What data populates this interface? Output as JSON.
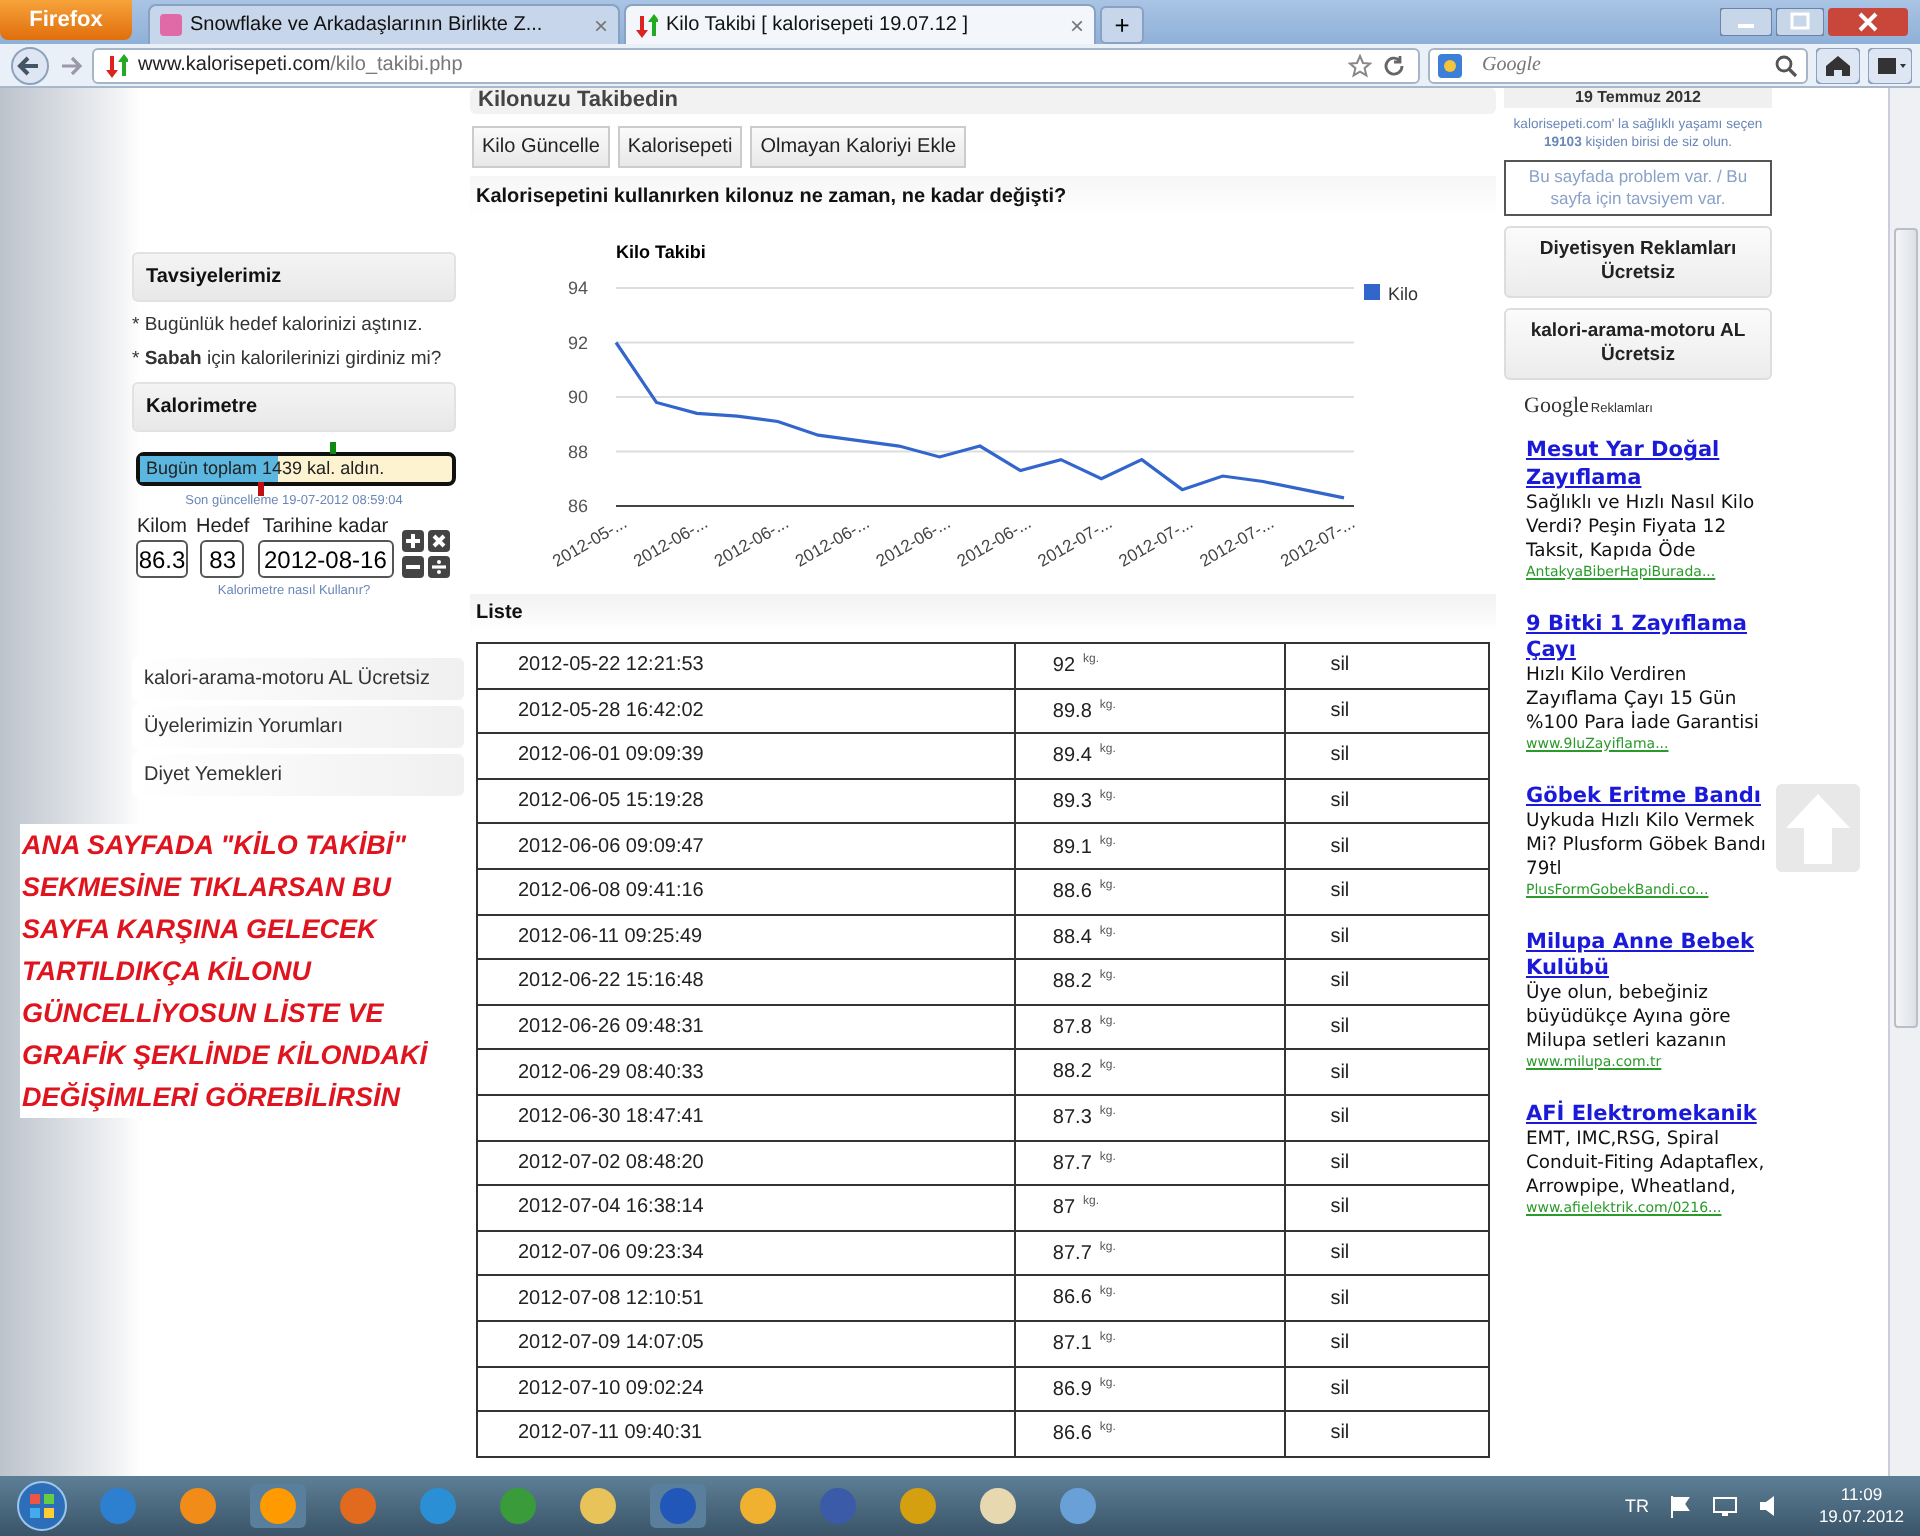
{
  "browser": {
    "menu_button": "Firefox",
    "tabs": [
      {
        "title": "Snowflake ve Arkadaşlarının Birlikte Z...",
        "selected": false
      },
      {
        "title": "Kilo Takibi [ kalorisepeti 19.07.12 ]",
        "selected": true
      }
    ],
    "close_label": "×",
    "new_tab_label": "+",
    "url_domain": "www.kalorisepeti.com",
    "url_path": "/kilo_takibi.php",
    "search": {
      "placeholder": "Google"
    }
  },
  "left": {
    "recommend_title": "Tavsiyelerimiz",
    "recommendations": [
      "* Bugünlük hedef kalorinizi aştınız.",
      "* **Sabah** için kalorilerinizi girdiniz mi?"
    ],
    "meter_title": "Kalorimetre",
    "meter": {
      "text": "Bugün toplam 1439 kal. aldın.",
      "level": 0.44
    },
    "last_update": "Son güncelleme 19-07-2012 08:59:04",
    "fields": [
      {
        "label": "Kilom",
        "value": "86.3"
      },
      {
        "label": "Hedef",
        "value": "83"
      },
      {
        "label": "Tarihine kadar",
        "value": "2012-08-16"
      }
    ],
    "help_link": "Kalorimetre nasıl Kullanır?",
    "menu": [
      "kalori-arama-motoru AL Ücretsiz",
      "Üyelerimizin Yorumları",
      "Diyet Yemekleri"
    ],
    "annotation": "ANA SAYFADA \"KİLO TAKİBİ\" SEKMESİNE TIKLARSAN BU SAYFA KARŞINA GELECEK TARTILDIKÇA KİLONU GÜNCELLİYOSUN LİSTE VE GRAFİK ŞEKLİNDE KİLONDAKİ DEĞİŞİMLERİ GÖREBİLİRSİN"
  },
  "main": {
    "title": "Kilonuzu Takibedin",
    "buttons": [
      "Kilo Güncelle",
      "Kalorisepeti",
      "Olmayan Kaloriyi Ekle"
    ],
    "question": "Kalorisepetini kullanırken kilonuz ne zaman, ne kadar değişti?",
    "chart_data": {
      "type": "line",
      "title": "Kilo Takibi",
      "categories": [
        "2012-05-...",
        null,
        "2012-06-...",
        null,
        "2012-06-...",
        null,
        "2012-06-...",
        null,
        "2012-06-...",
        null,
        "2012-06-...",
        null,
        "2012-07-...",
        null,
        "2012-07-...",
        null,
        "2012-07-...",
        null,
        "2012-07-..."
      ],
      "series": [
        {
          "name": "Kilo",
          "color": "#3366cc",
          "values": [
            92,
            89.8,
            89.4,
            89.3,
            89.1,
            88.6,
            88.4,
            88.2,
            87.8,
            88.2,
            87.3,
            87.7,
            87,
            87.7,
            86.6,
            87.1,
            86.9,
            86.6,
            86.3
          ]
        }
      ],
      "ylim": [
        86,
        94
      ],
      "yticks": [
        86,
        88,
        90,
        92,
        94
      ],
      "grid": true
    },
    "list_title": "Liste",
    "rows": [
      {
        "date": "2012-05-22 12:21:53",
        "weight": "92",
        "unit": "kg.",
        "action": "sil"
      },
      {
        "date": "2012-05-28 16:42:02",
        "weight": "89.8",
        "unit": "kg.",
        "action": "sil"
      },
      {
        "date": "2012-06-01 09:09:39",
        "weight": "89.4",
        "unit": "kg.",
        "action": "sil"
      },
      {
        "date": "2012-06-05 15:19:28",
        "weight": "89.3",
        "unit": "kg.",
        "action": "sil"
      },
      {
        "date": "2012-06-06 09:09:47",
        "weight": "89.1",
        "unit": "kg.",
        "action": "sil"
      },
      {
        "date": "2012-06-08 09:41:16",
        "weight": "88.6",
        "unit": "kg.",
        "action": "sil"
      },
      {
        "date": "2012-06-11 09:25:49",
        "weight": "88.4",
        "unit": "kg.",
        "action": "sil"
      },
      {
        "date": "2012-06-22 15:16:48",
        "weight": "88.2",
        "unit": "kg.",
        "action": "sil"
      },
      {
        "date": "2012-06-26 09:48:31",
        "weight": "87.8",
        "unit": "kg.",
        "action": "sil"
      },
      {
        "date": "2012-06-29 08:40:33",
        "weight": "88.2",
        "unit": "kg.",
        "action": "sil"
      },
      {
        "date": "2012-06-30 18:47:41",
        "weight": "87.3",
        "unit": "kg.",
        "action": "sil"
      },
      {
        "date": "2012-07-02 08:48:20",
        "weight": "87.7",
        "unit": "kg.",
        "action": "sil"
      },
      {
        "date": "2012-07-04 16:38:14",
        "weight": "87",
        "unit": "kg.",
        "action": "sil"
      },
      {
        "date": "2012-07-06 09:23:34",
        "weight": "87.7",
        "unit": "kg.",
        "action": "sil"
      },
      {
        "date": "2012-07-08 12:10:51",
        "weight": "86.6",
        "unit": "kg.",
        "action": "sil"
      },
      {
        "date": "2012-07-09 14:07:05",
        "weight": "87.1",
        "unit": "kg.",
        "action": "sil"
      },
      {
        "date": "2012-07-10 09:02:24",
        "weight": "86.9",
        "unit": "kg.",
        "action": "sil"
      },
      {
        "date": "2012-07-11 09:40:31",
        "weight": "86.6",
        "unit": "kg.",
        "action": "sil"
      }
    ]
  },
  "right": {
    "date": "19 Temmuz 2012",
    "members_text": "kalorisepeti.com' la sağlıklı yaşamı seçen **19103** kişiden birisi de siz olun.",
    "feedback": "Bu sayfada problem var. / Bu sayfa için tavsiyem var.",
    "buttons": [
      "Diyetisyen Reklamları Ücretsiz",
      "kalori-arama-motoru AL Ücretsiz"
    ],
    "ads_logo": "Google",
    "ads_label": "Reklamları",
    "ads": [
      {
        "title": "Mesut Yar Doğal Zayıflama",
        "body": "Sağlıklı ve Hızlı Nasıl Kilo Verdi? Peşin Fiyata 12 Taksit, Kapıda Öde",
        "url": "AntakyaBiberHapiBurada..."
      },
      {
        "title": "9 Bitki 1 Zayıflama Çayı",
        "body": "Hızlı Kilo Verdiren Zayıflama Çayı 15 Gün %100 Para İade Garantisi",
        "url": "www.9luZayiflama..."
      },
      {
        "title": "Göbek Eritme Bandı",
        "body": "Uykuda Hızlı Kilo Vermek Mi? Plusform Göbek Bandı 79tl",
        "url": "PlusFormGobekBandi.co..."
      },
      {
        "title": "Milupa Anne Bebek Kulübü",
        "body": "Üye olun, bebeğiniz büyüdükçe Ayına göre Milupa setleri kazanın",
        "url": "www.milupa.com.tr"
      },
      {
        "title": "AFİ Elektromekanik",
        "body": "EMT, IMC,RSG, Spiral Conduit-Fiting Adaptaflex, Arrowpipe, Wheatland,",
        "url": "www.afielektrik.com/0216..."
      }
    ]
  },
  "taskbar": {
    "language": "TR",
    "time": "11:09",
    "date": "19.07.2012"
  }
}
